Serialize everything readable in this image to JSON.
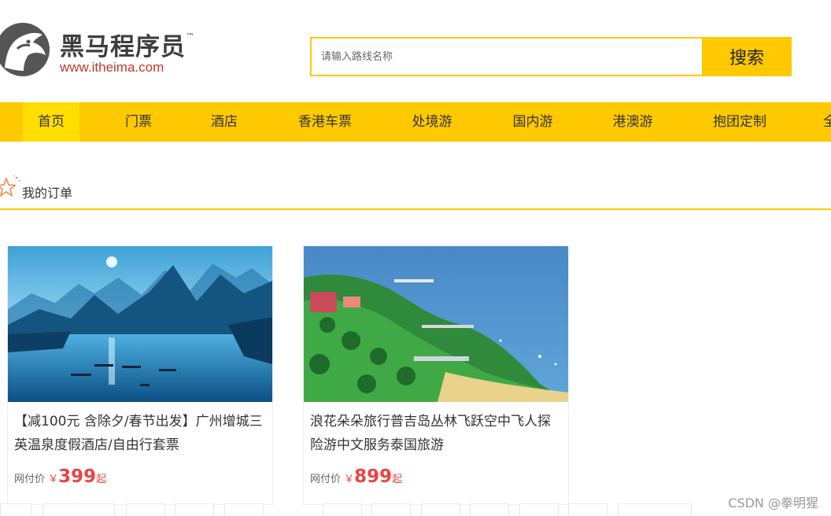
{
  "brand": {
    "name": "黑马程序员",
    "trademark": "™",
    "url": "www.itheima.com",
    "accent_color": "#ffc900",
    "logo_icon": "horse-head-icon"
  },
  "search": {
    "placeholder": "请输入路线名称",
    "button_label": "搜索"
  },
  "nav": {
    "items": [
      {
        "label": "首页",
        "active": true
      },
      {
        "label": "门票"
      },
      {
        "label": "酒店"
      },
      {
        "label": "香港车票"
      },
      {
        "label": "处境游"
      },
      {
        "label": "国内游"
      },
      {
        "label": "港澳游"
      },
      {
        "label": "抱团定制"
      },
      {
        "label": "全"
      }
    ]
  },
  "section": {
    "title": "我的订单",
    "icon": "star-icon"
  },
  "products": [
    {
      "title": "【减100元 含除夕/春节出发】广州增城三英温泉度假酒店/自由行套票",
      "price_prefix": "网付价",
      "currency": "￥",
      "price": "399",
      "price_suffix": "起",
      "image": "guilin-river-landscape"
    },
    {
      "title": "浪花朵朵旅行普吉岛丛林飞跃空中飞人探险游中文服务泰国旅游",
      "price_prefix": "网付价",
      "currency": "￥",
      "price": "899",
      "price_suffix": "起",
      "image": "coastal-island-resort"
    }
  ],
  "watermark": "CSDN @拳明猩",
  "price_color": "#e84545"
}
